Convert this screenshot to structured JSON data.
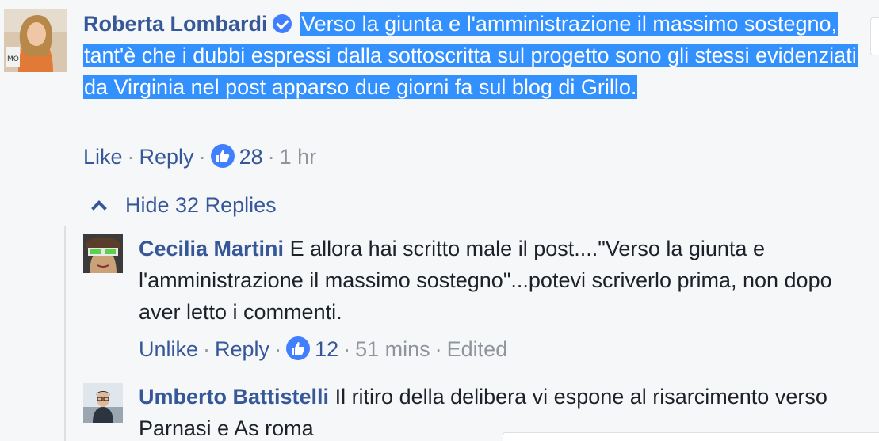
{
  "comment": {
    "author": "Roberta Lombardi",
    "text": "Verso la giunta e l'amministrazione il massimo sostegno, tant'è che i dubbi espressi dalla sottoscritta sul progetto sono gli stessi evidenziati da Virginia nel post apparso due giorni fa sul blog di Grillo.",
    "actions": {
      "like": "Like",
      "reply": "Reply",
      "likes_count": "28",
      "time": "1 hr"
    }
  },
  "replies_toggle": "Hide 32 Replies",
  "replies": [
    {
      "author": "Cecilia Martini",
      "text": "E allora hai scritto male il post....\"Verso la giunta e l'amministrazione il massimo sostegno\"...potevi scriverlo prima, non dopo aver letto i commenti.",
      "actions": {
        "like": "Unlike",
        "reply": "Reply",
        "likes_count": "12",
        "time": "51 mins",
        "edited": "Edited"
      }
    },
    {
      "author": "Umberto Battistelli",
      "text": "Il ritiro della delibera vi espone al risarcimento verso Parnasi e As roma"
    }
  ],
  "colors": {
    "author": "#365899",
    "highlight": "#3390ff",
    "like_badge": "#4080ff",
    "meta": "#90949c"
  },
  "icons": [
    "verified-badge-icon",
    "like-thumb-icon",
    "chevron-up-icon"
  ]
}
